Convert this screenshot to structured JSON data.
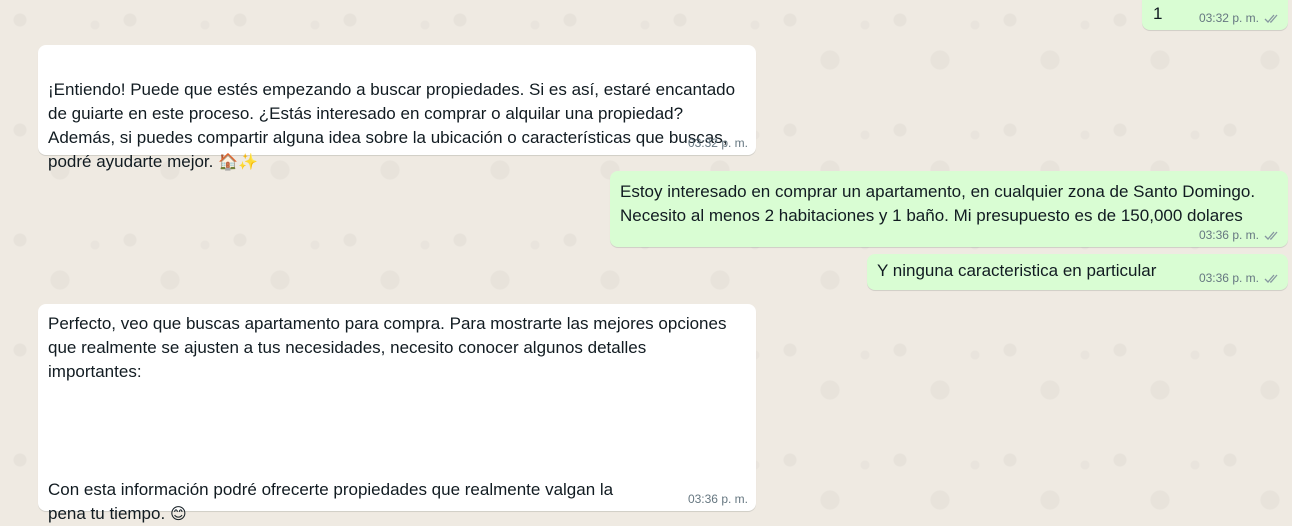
{
  "chat": {
    "messages": [
      {
        "direction": "out",
        "text": "1",
        "time": "03:32 p. m.",
        "status_icon": "double-check-icon"
      },
      {
        "direction": "in",
        "text": "¡Entiendo! Puede que estés empezando a buscar propiedades. Si es así, estaré encantado\nde guiarte en este proceso. ¿Estás interesado en comprar o alquilar una propiedad?\nAdemás, si puedes compartir alguna idea sobre la ubicación o características que buscas,\npodré ayudarte mejor.",
        "emoji": "🏠✨",
        "time": "03:32 p. m."
      },
      {
        "direction": "out",
        "text": "Estoy interesado en comprar un apartamento, en cualquier zona de Santo Domingo.\nNecesito al menos 2 habitaciones y 1 baño. Mi presupuesto es de 150,000 dolares",
        "time": "03:36 p. m.",
        "status_icon": "double-check-icon"
      },
      {
        "direction": "out",
        "text": "Y ninguna caracteristica en particular",
        "time": "03:36 p. m.",
        "status_icon": "double-check-icon"
      },
      {
        "direction": "in",
        "text": "Perfecto, veo que buscas apartamento para compra. Para mostrarte las mejores opciones\nque realmente se ajusten a tus necesidades, necesito conocer algunos detalles\nimportantes:",
        "text2": "Con esta información podré ofrecerte propiedades que realmente valgan la\npena tu tiempo.",
        "emoji": "😊",
        "time": "03:36 p. m."
      }
    ]
  },
  "colors": {
    "background": "#efeae2",
    "incoming_bubble": "#ffffff",
    "outgoing_bubble": "#d9fdd3",
    "timestamp": "#667781",
    "text": "#111b21"
  }
}
